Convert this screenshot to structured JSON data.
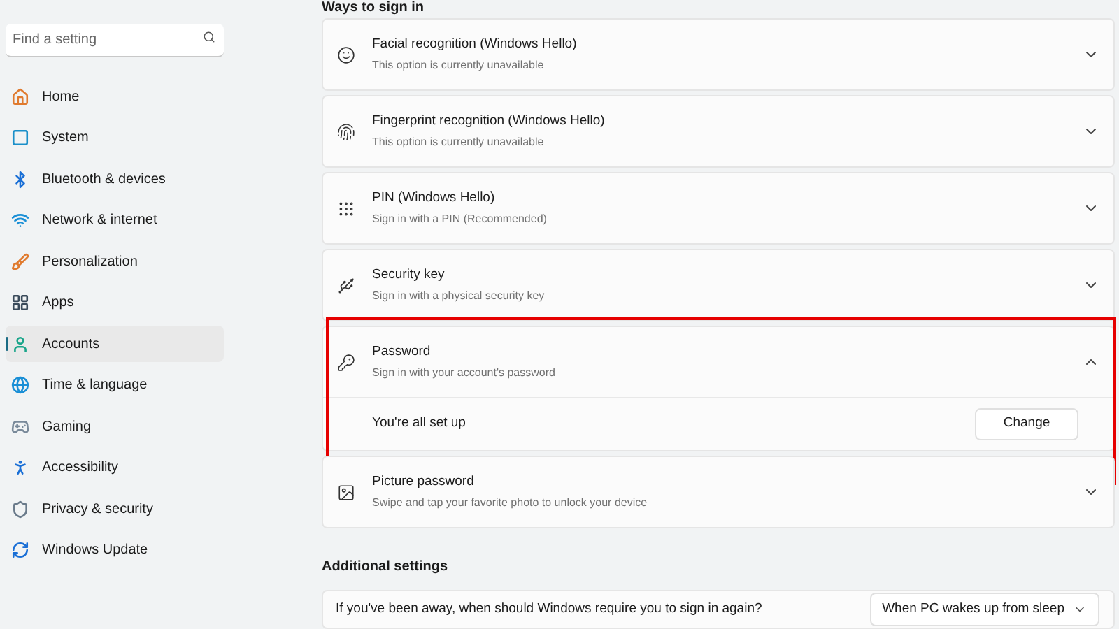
{
  "sidebar": {
    "search": {
      "placeholder": "Find a setting"
    },
    "items": [
      {
        "label": "Home",
        "kind": "home",
        "selected": false
      },
      {
        "label": "System",
        "kind": "system",
        "selected": false
      },
      {
        "label": "Bluetooth & devices",
        "kind": "bluetooth",
        "selected": false
      },
      {
        "label": "Network & internet",
        "kind": "network",
        "selected": false
      },
      {
        "label": "Personalization",
        "kind": "brush",
        "selected": false
      },
      {
        "label": "Apps",
        "kind": "apps",
        "selected": false
      },
      {
        "label": "Accounts",
        "kind": "accounts",
        "selected": true
      },
      {
        "label": "Time & language",
        "kind": "time",
        "selected": false
      },
      {
        "label": "Gaming",
        "kind": "gaming",
        "selected": false
      },
      {
        "label": "Accessibility",
        "kind": "accessibility",
        "selected": false
      },
      {
        "label": "Privacy & security",
        "kind": "privacy",
        "selected": false
      },
      {
        "label": "Windows Update",
        "kind": "update",
        "selected": false
      }
    ]
  },
  "sign_in": {
    "heading": "Ways to sign in",
    "options": [
      {
        "kind": "face",
        "title": "Facial recognition (Windows Hello)",
        "subtitle": "This option is currently unavailable",
        "expanded": false,
        "highlighted": false
      },
      {
        "kind": "fingerprint",
        "title": "Fingerprint recognition (Windows Hello)",
        "subtitle": "This option is currently unavailable",
        "expanded": false,
        "highlighted": false
      },
      {
        "kind": "pin",
        "title": "PIN (Windows Hello)",
        "subtitle": "Sign in with a PIN (Recommended)",
        "expanded": false,
        "highlighted": false
      },
      {
        "kind": "key",
        "title": "Security key",
        "subtitle": "Sign in with a physical security key",
        "expanded": false,
        "highlighted": false
      },
      {
        "kind": "password",
        "title": "Password",
        "subtitle": "Sign in with your account's password",
        "expanded": true,
        "highlighted": true,
        "detail": "You're all set up",
        "button": "Change"
      },
      {
        "kind": "picture",
        "title": "Picture password",
        "subtitle": "Swipe and tap your favorite photo to unlock your device",
        "expanded": false,
        "highlighted": false
      }
    ]
  },
  "additional": {
    "heading": "Additional settings",
    "question": "If you've been away, when should Windows require you to sign in again?",
    "dropdown": "When PC wakes up from sleep"
  }
}
